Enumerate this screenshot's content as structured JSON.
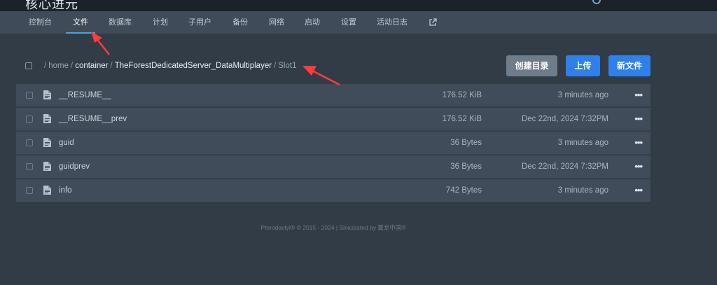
{
  "header": {
    "site_title": "核心进元"
  },
  "nav": {
    "items": [
      "控制台",
      "文件",
      "数据库",
      "计划",
      "子用户",
      "备份",
      "网络",
      "启动",
      "设置",
      "活动日志"
    ],
    "active_index": 1
  },
  "breadcrumb": {
    "segments": [
      {
        "text": "/",
        "type": "sep"
      },
      {
        "text": "home",
        "type": "plain"
      },
      {
        "text": "/",
        "type": "sep"
      },
      {
        "text": "container",
        "type": "link"
      },
      {
        "text": "/",
        "type": "sep"
      },
      {
        "text": "TheForestDedicatedServer_DataMultiplayer",
        "type": "link"
      },
      {
        "text": "/",
        "type": "sep"
      },
      {
        "text": "Slot1",
        "type": "plain"
      }
    ]
  },
  "actions": {
    "create_dir": "创建目录",
    "upload": "上传",
    "new_file": "新文件"
  },
  "files": [
    {
      "name": "__RESUME__",
      "size": "176.52 KiB",
      "modified": "3 minutes ago"
    },
    {
      "name": "__RESUME__prev",
      "size": "176.52 KiB",
      "modified": "Dec 22nd, 2024 7:32PM"
    },
    {
      "name": "guid",
      "size": "36 Bytes",
      "modified": "3 minutes ago"
    },
    {
      "name": "guidprev",
      "size": "36 Bytes",
      "modified": "Dec 22nd, 2024 7:32PM"
    },
    {
      "name": "info",
      "size": "742 Bytes",
      "modified": "3 minutes ago"
    }
  ],
  "row_menu_glyph": "•••",
  "footer": {
    "text": "Pterodactyl® © 2015 - 2024 | Sinicizated by 翼龙中国®"
  },
  "colors": {
    "accent": "#2f80e9",
    "annotation_arrow": "#ff3b3b",
    "active_tab_underline": "#4aa3df"
  },
  "icons": {
    "external_link": "external-link-icon",
    "file": "file-icon",
    "more": "more-horizontal-icon"
  }
}
